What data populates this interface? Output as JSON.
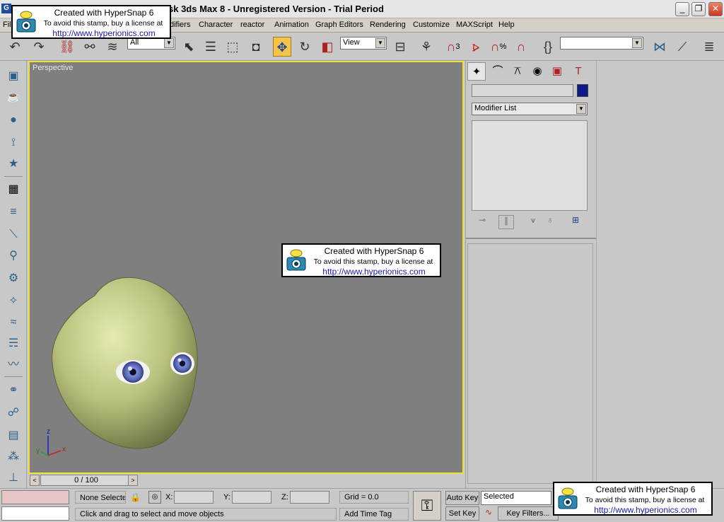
{
  "window": {
    "title": "sk 3ds Max 8  -  Unregistered Version - Trial Period",
    "app_icon": "G",
    "controls": [
      "_",
      "❐",
      "✕"
    ]
  },
  "menu": {
    "items": [
      "Fil",
      "difiers",
      "Character",
      "reactor",
      "Animation",
      "Graph Editors",
      "Rendering",
      "Customize",
      "MAXScript",
      "Help"
    ]
  },
  "toolbar": {
    "selection_filter": "All",
    "reference_coordinate": "View",
    "snap_value": "3",
    "percent_label": "%",
    "named_selection": ""
  },
  "viewport": {
    "label": "Perspective",
    "axis_labels": {
      "x": "x",
      "y": "y",
      "z": "z"
    },
    "background": "#7f7f7f",
    "border_active": "#f1e03a"
  },
  "timeline": {
    "frame": "0 / 100",
    "prev": "<",
    "next": ">"
  },
  "command_panel": {
    "object_name": "",
    "object_color": "#0c1a8c",
    "modifier_dropdown": "Modifier List"
  },
  "status": {
    "selection": "None Selecte",
    "x_label": "X:",
    "y_label": "Y:",
    "z_label": "Z:",
    "x_value": "",
    "y_value": "",
    "z_value": "",
    "grid": "Grid = 0.0",
    "prompt": "Click and drag to select and move objects",
    "add_time_tag": "Add Time Tag",
    "auto_key": "Auto Key",
    "set_key": "Set Key",
    "key_mode": "Selected",
    "key_filters": "Key Filters..."
  },
  "watermark": {
    "line1": "Created with HyperSnap 6",
    "line2": "To avoid this stamp, buy a license at",
    "line3": "http://www.hyperionics.com"
  },
  "icons": {
    "undo": "↶",
    "redo": "↷",
    "select": "⬉",
    "move": "✥",
    "rotate": "↻",
    "key": "⚿"
  }
}
